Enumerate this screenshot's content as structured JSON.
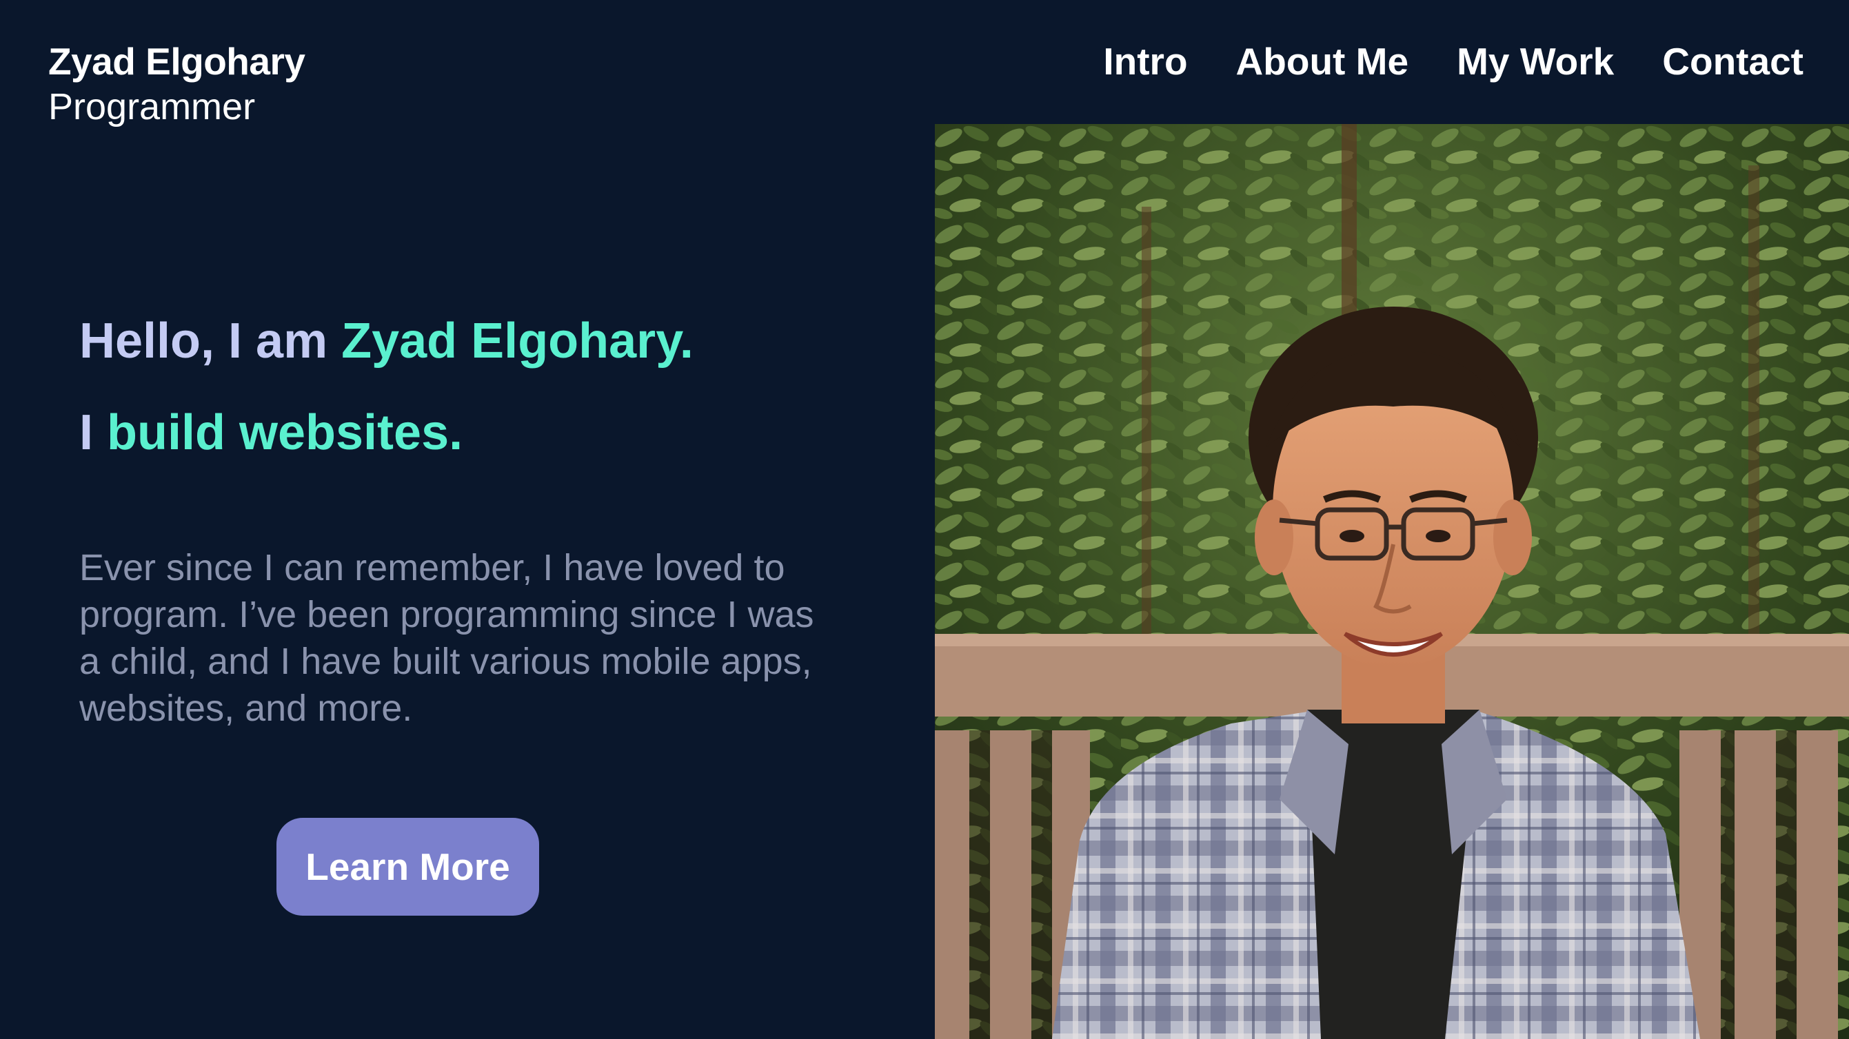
{
  "brand": {
    "name": "Zyad Elgohary",
    "role": "Programmer"
  },
  "nav": {
    "items": [
      {
        "label": "Intro"
      },
      {
        "label": "About Me"
      },
      {
        "label": "My Work"
      },
      {
        "label": "Contact"
      }
    ]
  },
  "hero": {
    "greeting_prefix": "Hello, I am ",
    "greeting_name": "Zyad Elgohary.",
    "tagline_prefix": "I ",
    "tagline_highlight": "build websites.",
    "description": "Ever since I can remember, I have loved to program. I’ve been programming since I was a child, and I have built various mobile apps, websites, and more.",
    "cta_label": "Learn More"
  },
  "photo": {
    "icon": "portrait-photo"
  },
  "colors": {
    "background": "#0a172c",
    "accent": "#5af0cf",
    "muted_heading": "#c4cbf3",
    "body_text": "#8a93ad",
    "button": "#7b80cd"
  }
}
